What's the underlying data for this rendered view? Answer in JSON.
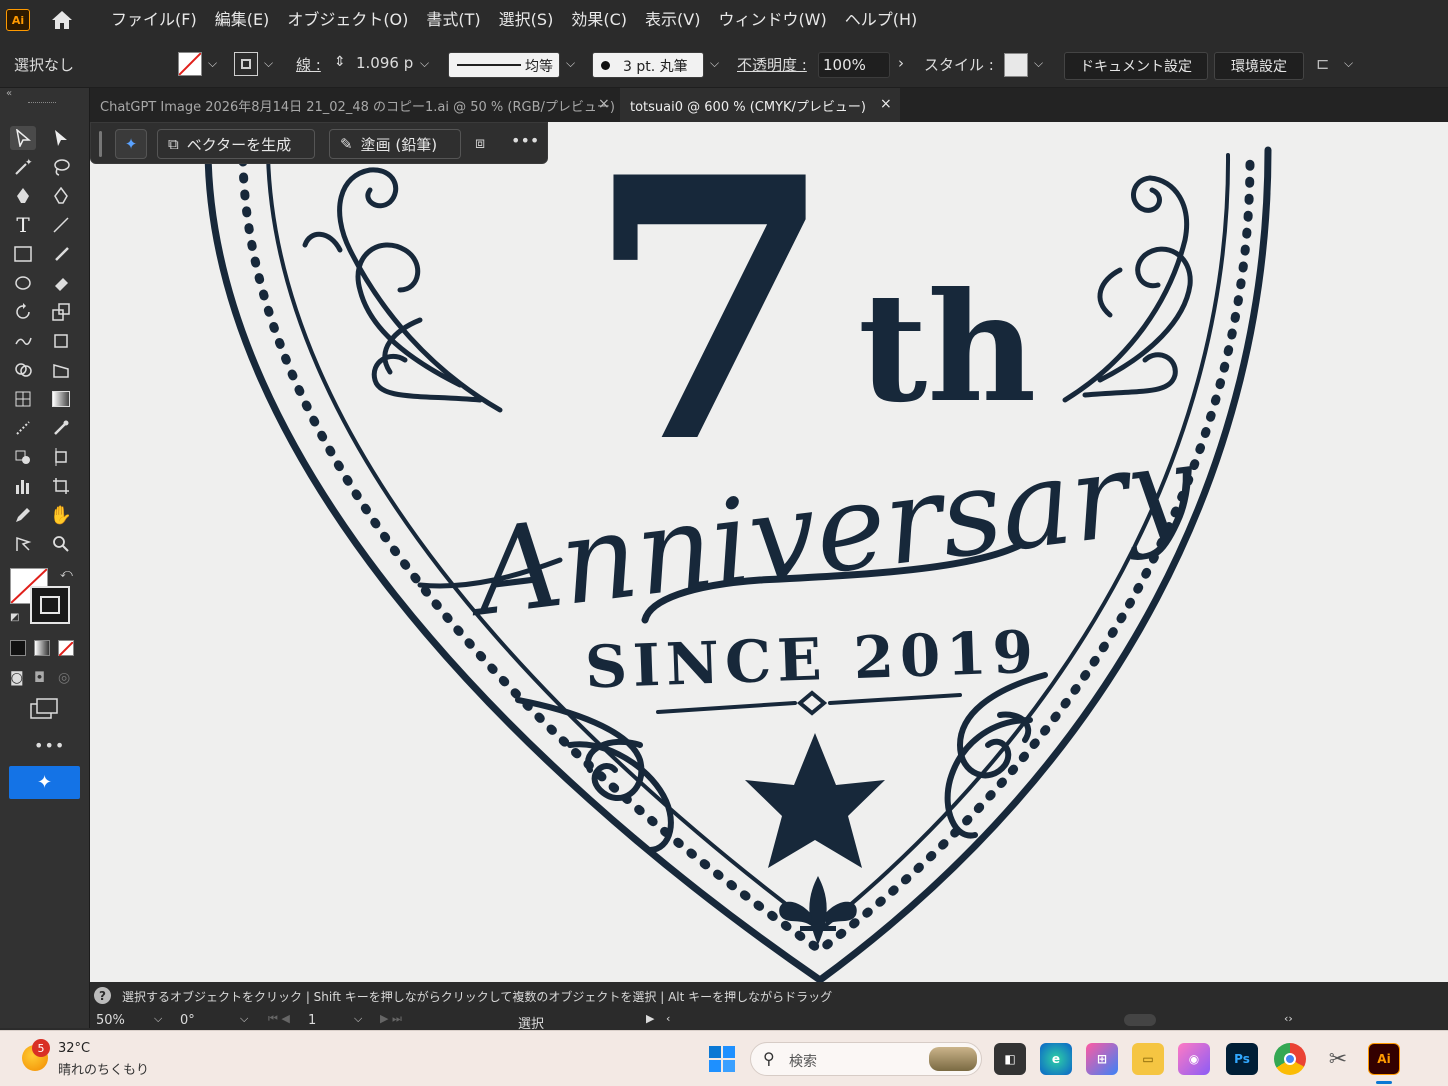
{
  "app": {
    "logo_text": "Ai"
  },
  "menu": [
    "ファイル(F)",
    "編集(E)",
    "オブジェクト(O)",
    "書式(T)",
    "選択(S)",
    "効果(C)",
    "表示(V)",
    "ウィンドウ(W)",
    "ヘルプ(H)"
  ],
  "control": {
    "selection": "選択なし",
    "stroke_label": "線 :",
    "stroke_weight": "1.096 p",
    "stroke_profile": "均等",
    "brush": "3 pt. 丸筆",
    "opacity_label": "不透明度 :",
    "opacity_value": "100%",
    "style_label": "スタイル :",
    "document_settings": "ドキュメント設定",
    "preferences": "環境設定"
  },
  "tabs": [
    {
      "label": "ChatGPT Image 2026年8月14日 21_02_48 のコピー1.ai @ 50 % (RGB/プレビュー)",
      "active": false
    },
    {
      "label": "totsuai0 @ 600 % (CMYK/プレビュー)",
      "active": true
    }
  ],
  "contextbar": {
    "vectorize": "ベクターを生成",
    "paint": "塗画 (鉛筆)"
  },
  "artwork": {
    "big_number": "7",
    "suffix": "th",
    "script_word": "Anniversary",
    "since": "SINCE 2019",
    "ink_color": "#17283a"
  },
  "status": {
    "hint": "選択するオブジェクトをクリック | Shift キーを押しながらクリックして複数のオブジェクトを選択 | Alt キーを押しながらドラッグ",
    "zoom": "50%",
    "angle": "0°",
    "artboard": "1",
    "tool_name": "選択"
  },
  "taskbar": {
    "weather_temp": "32°C",
    "weather_desc": "晴れのちくもり",
    "weather_badge": "5",
    "search_placeholder": "検索"
  }
}
